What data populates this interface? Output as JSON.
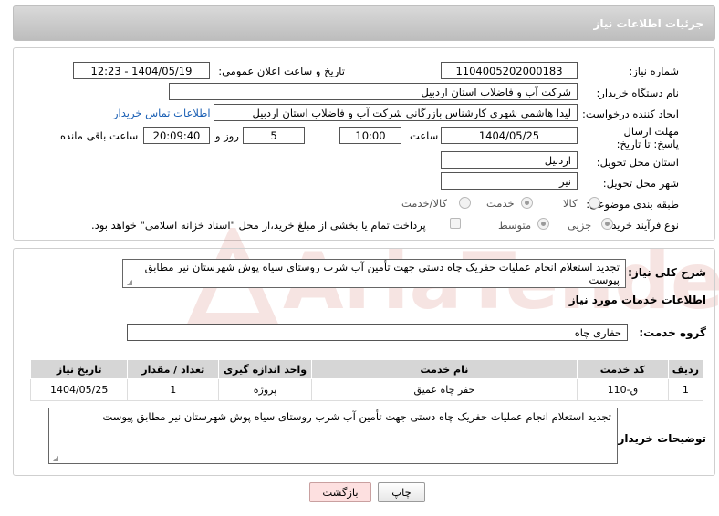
{
  "header": {
    "title": "جزئیات اطلاعات نیاز"
  },
  "form": {
    "need_number_label": "شماره نیاز:",
    "need_number": "1104005202000183",
    "announce_label": "تاریخ و ساعت اعلان عمومی:",
    "announce_value": "1404/05/19 - 12:23",
    "buyer_org_label": "نام دستگاه خریدار:",
    "buyer_org": "شرکت آب و فاضلاب استان اردبیل",
    "creator_label": "ایجاد کننده درخواست:",
    "creator": "لیدا  هاشمی شهری کارشناس بازرگانی شرکت آب و فاضلاب استان اردبیل",
    "contact_link": "اطلاعات تماس خریدار",
    "deadline_label": "مهلت ارسال پاسخ: تا تاریخ:",
    "deadline_date": "1404/05/25",
    "time_label": "ساعت",
    "deadline_time": "10:00",
    "days_value": "5",
    "days_label": "روز و",
    "remaining_time": "20:09:40",
    "remaining_label": "ساعت باقی مانده",
    "province_label": "استان محل تحویل:",
    "province": "اردبیل",
    "city_label": "شهر محل تحویل:",
    "city": "نیر",
    "category_label": "طبقه بندی موضوعی:",
    "category_options": [
      "کالا",
      "خدمت",
      "کالا/خدمت"
    ],
    "category_selected": "خدمت",
    "process_label": "نوع فرآیند خرید :",
    "process_options": [
      "جزیی",
      "متوسط"
    ],
    "process_selected": "جزیی",
    "payment_note": "پرداخت تمام یا بخشی از مبلغ خرید،از محل \"اسناد خزانه اسلامی\" خواهد بود."
  },
  "description": {
    "label": "شرح کلی نیاز:",
    "text": "تجدید استعلام انجام عملیات حفریک چاه دستی جهت تأمین آب شرب روستای سیاه پوش شهرستان  نیر مطابق پیوست"
  },
  "services": {
    "section_title": "اطلاعات خدمات مورد نیاز",
    "group_label": "گروه خدمت:",
    "group_value": "حفاری چاه",
    "columns": [
      "ردیف",
      "کد خدمت",
      "نام خدمت",
      "واحد اندازه گیری",
      "تعداد / مقدار",
      "تاریخ نیاز"
    ],
    "rows": [
      [
        "1",
        "ق-110",
        "حفر چاه عمیق",
        "پروژه",
        "1",
        "1404/05/25"
      ]
    ]
  },
  "buyer_notes": {
    "label": "توضیحات خریدار:",
    "text": "تجدید استعلام انجام عملیات حفریک چاه دستی جهت تأمین آب شرب روستای سیاه پوش شهرستان  نیر مطابق پیوست"
  },
  "buttons": {
    "print": "چاپ",
    "back": "بازگشت"
  },
  "watermark": {
    "text": "AriaTender.neT"
  }
}
